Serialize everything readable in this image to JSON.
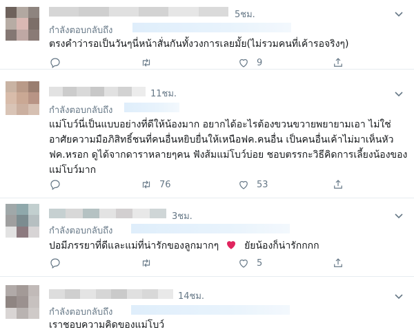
{
  "tweets": [
    {
      "time": "5ชม.",
      "reply_label": "กำลังตอบกลับถึง",
      "text": "ตรงคำว่ารอเป็นวันๆนี่หน้าสั่นกันทั้งวงการเลยมั้ย(ไม่รวมคนที่เค้ารอจริงๆ)",
      "replies": "",
      "retweets": "",
      "likes": "9",
      "avatar_colors": [
        "#6e625c",
        "#b2a8a1",
        "#8e847f",
        "#b7aca4",
        "#d9b8b3",
        "#7d6f69",
        "#847773",
        "#bfa8a4",
        "#8a7b76"
      ],
      "name_colors": [
        "#d6d6d6",
        "#cfcfcf",
        "#e0e0e0",
        "#d3d3d3",
        "#e6e6e6",
        "#dadada"
      ]
    },
    {
      "time": "11ชม.",
      "reply_label": "กำลังตอบกลับถึง",
      "text": "แม่โบว์นี่เป็นแบบอย่างที่ดีให้น้องมาก อยากได้อะไรต้องขวนขวายพยายามเอา ไม่ใช่อาศัยความมือภิสิทธิ์ชนที่คนอื่นหยิบยื่นให้เหนือฟค.คนอื่น เป็นคนอื่นเค้าไม่มาเห็นหัวฟค.หรอก ดูได้จากดาราหลายๆคน ฟังส้มแม่โบว์บ่อย ชอบตรรกะวิธีคิดการเลี้ยงน้องของแม่โบว์มาก",
      "replies": "",
      "retweets": "76",
      "likes": "53",
      "avatar_colors": [
        "#c9b3a3",
        "#b99a88",
        "#9a7e70",
        "#d8bcaa",
        "#caa894",
        "#b89485",
        "#d9c4b6",
        "#cbb0a0",
        "#d6c0b2"
      ],
      "name_colors": [
        "#e2e2e2",
        "#cccccc",
        "#d9d9d9",
        "#c8c8c8",
        "#e1e1e1",
        "#d2d2d2",
        "#ececec"
      ]
    },
    {
      "time": "3ชม.",
      "reply_label": "กำลังตอบกลับถึง",
      "text": "ปอมีภรรยาที่ดีและแม่ที่น่ารักของลูกมากๆ",
      "text_after": "ยัยน้องก็น่ารักกกก",
      "replies": "",
      "retweets": "",
      "likes": "5",
      "avatar_colors": [
        "#a0a8a9",
        "#8fa8ab",
        "#c2cfcf",
        "#9f9f9f",
        "#7c8c90",
        "#b6bfc1",
        "#e2e2e2",
        "#8c7a7f",
        "#d7d4d5"
      ],
      "name_colors": [
        "#c6d0d1",
        "#d8d8d8",
        "#b5c2c3",
        "#e3e3e3",
        "#d2cfd0",
        "#e8e8e8",
        "#cfd6d7"
      ]
    },
    {
      "time": "14ชม.",
      "reply_label": "กำลังตอบกลับถึง",
      "text": "เราชอบความคิดของแม่โบว์",
      "replies": "",
      "retweets": "",
      "likes": "",
      "avatar_colors": [
        "#b1aaa8",
        "#a39a97",
        "#c1bab8",
        "#8f8582",
        "#9b918f",
        "#c7c1bf",
        "#d9d5d4",
        "#b9b3b1",
        "#cfcac8"
      ],
      "name_colors": [
        "#dddddd",
        "#cfcfcf",
        "#e4e4e4",
        "#d6d6d6",
        "#cacaca",
        "#e0e0e0",
        "#d8d8d8",
        "#e9e9e9"
      ]
    }
  ],
  "colors": {
    "muted": "#657786",
    "heart": "#e0245e",
    "divider": "#e6ecf0"
  },
  "icons": [
    "reply-icon",
    "retweet-icon",
    "like-icon",
    "share-icon",
    "chevron-down-icon",
    "heart-emoji"
  ]
}
